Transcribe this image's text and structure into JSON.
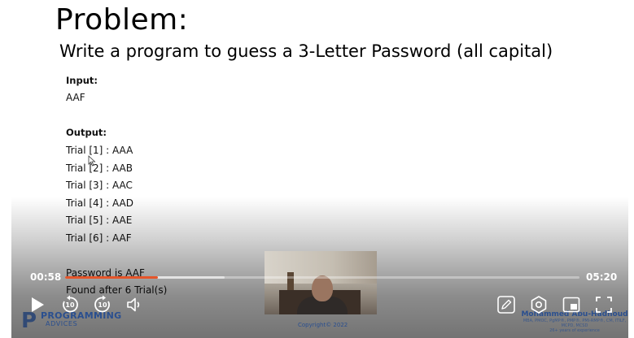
{
  "slide": {
    "title": "Problem:",
    "subtitle": "Write a program to guess a 3-Letter Password (all capital)",
    "input_label": "Input:",
    "input_value": "AAF",
    "output_label": "Output:",
    "trials": [
      "Trial [1] : AAA",
      "Trial [2] : AAB",
      "Trial [3] : AAC",
      "Trial [4] : AAD",
      "Trial [5] : AAE",
      "Trial [6] : AAF"
    ],
    "result_line": "Password is AAF",
    "found_line": "Found after 6 Trial(s)"
  },
  "branding": {
    "left_logo_line1": "PROGRAMMING",
    "left_logo_line2": "ADVICES",
    "right_logo_name": "Mohammed Abu-Hadhoud",
    "right_logo_info": "MBA, PMOC, PgMP®, PMP®, PMI-RMP®, CM, ITILF, MCPD, MCSD",
    "right_logo_info2": "26+ years of experience",
    "copyright": "Copyright© 2022"
  },
  "player": {
    "current_time": "00:58",
    "duration": "05:20",
    "progress": 0.181,
    "buffered": 0.31,
    "skip_back_seconds": "10",
    "skip_forward_seconds": "10",
    "accent_color": "#e5552a",
    "icons": {
      "play": "play-icon",
      "rewind": "rewind-10-icon",
      "forward": "forward-10-icon",
      "volume": "volume-icon",
      "notes": "pencil-icon",
      "settings": "gear-icon",
      "pip": "picture-in-picture-icon",
      "fullscreen": "fullscreen-icon"
    }
  }
}
